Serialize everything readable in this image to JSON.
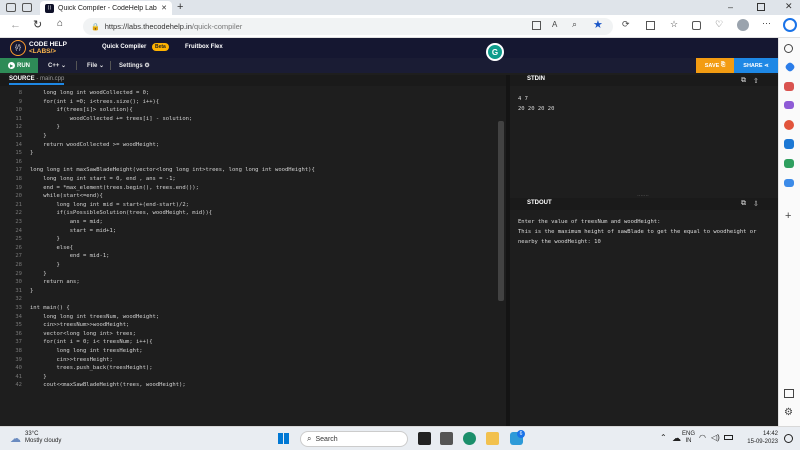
{
  "browser": {
    "tab_title": "Quick Compiler - CodeHelp Labs",
    "close": "✕",
    "new_tab": "+",
    "url_host": "https://labs.thecodehelp.in",
    "url_path": "/quick-compiler"
  },
  "app": {
    "logo_line1": "CODE HELP",
    "logo_line2": "<LABS/>",
    "nav_quick_compiler": "Quick Compiler",
    "nav_beta": "Beta",
    "nav_fruitbox": "Fruitbox Flex",
    "run_label": "RUN",
    "lang_label": "C++ ⌄",
    "file_label": "File ⌄",
    "settings_label": "Settings",
    "save_label": "SAVE",
    "share_label": "SHARE",
    "source_label": "SOURCE",
    "source_file": " - main.cpp",
    "grammarly_letter": "G",
    "stdin_label": "STDIN",
    "stdout_label": "STDOUT"
  },
  "stdin": [
    "4 7",
    "20 20 20 20"
  ],
  "stdout": [
    "Enter the value of treesNum and woodHeight:",
    "This is the maximum height of sawBlade to get the equal to woodheight or",
    "nearby the woodHeight: 10"
  ],
  "code": [
    {
      "n": "8",
      "t": "    long long int woodCollected = 0;"
    },
    {
      "n": "9",
      "t": "    for(int i =0; i<trees.size(); i++){"
    },
    {
      "n": "10",
      "t": "        if(trees[i]> solution){"
    },
    {
      "n": "11",
      "t": "            woodCollected += trees[i] - solution;"
    },
    {
      "n": "12",
      "t": "        }"
    },
    {
      "n": "13",
      "t": "    }"
    },
    {
      "n": "14",
      "t": "    return woodCollected >= woodHeight;"
    },
    {
      "n": "15",
      "t": "}"
    },
    {
      "n": "16",
      "t": ""
    },
    {
      "n": "17",
      "t": "long long int maxSawBladeHeight(vector<long long int>trees, long long int woodHeight){"
    },
    {
      "n": "18",
      "t": "    long long int start = 0, end , ans = -1;"
    },
    {
      "n": "19",
      "t": "    end = *max_element(trees.begin(), trees.end());"
    },
    {
      "n": "20",
      "t": "    while(start<=end){"
    },
    {
      "n": "21",
      "t": "        long long int mid = start+(end-start)/2;"
    },
    {
      "n": "22",
      "t": "        if(isPossibleSolution(trees, woodHeight, mid)){"
    },
    {
      "n": "23",
      "t": "            ans = mid;"
    },
    {
      "n": "24",
      "t": "            start = mid+1;"
    },
    {
      "n": "25",
      "t": "        }"
    },
    {
      "n": "26",
      "t": "        else{"
    },
    {
      "n": "27",
      "t": "            end = mid-1;"
    },
    {
      "n": "28",
      "t": "        }"
    },
    {
      "n": "29",
      "t": "    }"
    },
    {
      "n": "30",
      "t": "    return ans;"
    },
    {
      "n": "31",
      "t": "}"
    },
    {
      "n": "32",
      "t": ""
    },
    {
      "n": "33",
      "t": "int main() {"
    },
    {
      "n": "34",
      "t": "    long long int treesNum, woodHeight;"
    },
    {
      "n": "35",
      "t": "    cin>>treesNum>>woodHeight;"
    },
    {
      "n": "36",
      "t": "    vector<long long int> trees;"
    },
    {
      "n": "37",
      "t": "    for(int i = 0; i< treesNum; i++){"
    },
    {
      "n": "38",
      "t": "        long long int treesHeight;"
    },
    {
      "n": "39",
      "t": "        cin>>treesHeight;"
    },
    {
      "n": "40",
      "t": "        trees.push_back(treesHeight);"
    },
    {
      "n": "41",
      "t": "    }"
    },
    {
      "n": "42",
      "t": "    cout<<maxSawBladeHeight(trees, woodHeight);"
    }
  ],
  "taskbar": {
    "temp": "33°C",
    "weather": "Mostly cloudy",
    "search": "Search",
    "lang1": "ENG",
    "lang2": "IN",
    "time": "14:42",
    "date": "15-09-2023",
    "notif_count": "6"
  }
}
